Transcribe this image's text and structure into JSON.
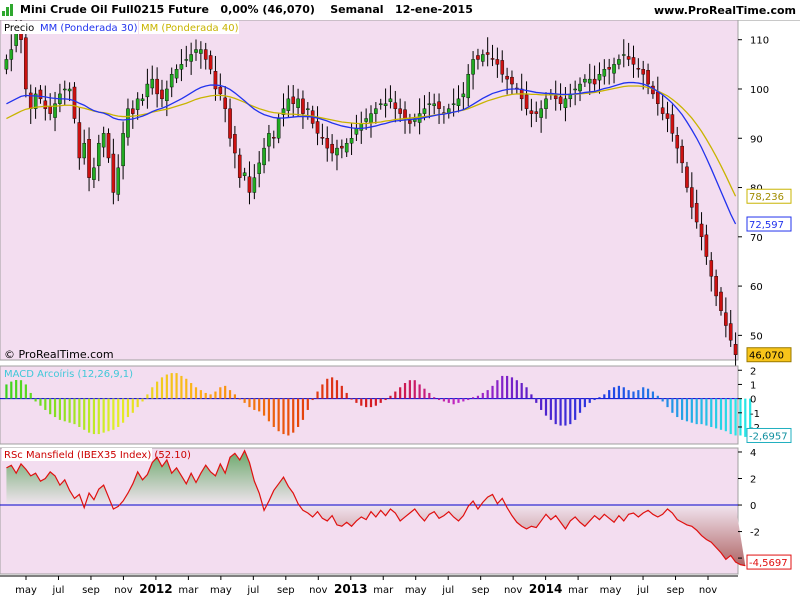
{
  "header": {
    "instrument": "Mini Crude Oil Full0215 Future",
    "change": "0,00% (46,070)",
    "period": "Semanal",
    "date": "12-ene-2015",
    "site": "www.ProRealTime.com"
  },
  "colors": {
    "panel_bg": "#f3ddf0",
    "ma30": "#2233ee",
    "ma40": "#c8b400",
    "candle_up": "#22aa22",
    "candle_down": "#cc1111",
    "rsc_line": "#e01010"
  },
  "chart_data": [
    {
      "type": "candlestick",
      "panel": "price",
      "legend": [
        "Precio",
        "MM (Ponderada 30)",
        "MM (Ponderada 40)"
      ],
      "y_ticks": [
        110,
        100,
        90,
        80,
        70,
        60,
        50
      ],
      "ylim": [
        45,
        114
      ],
      "last_labels": {
        "ma40": "78,236",
        "ma30": "72,597",
        "close": "46,070"
      },
      "watermark": "© ProRealTime.com",
      "x_ticks": [
        "may",
        "jul",
        "sep",
        "nov",
        "2012",
        "mar",
        "may",
        "jul",
        "sep",
        "nov",
        "2013",
        "mar",
        "may",
        "jul",
        "sep",
        "nov",
        "2014",
        "mar",
        "may",
        "jul",
        "sep",
        "nov"
      ],
      "close": [
        106,
        108,
        112,
        110,
        100,
        96,
        99,
        98,
        96,
        95,
        97,
        99,
        100,
        100,
        94,
        86,
        89,
        82,
        84,
        89,
        91,
        86,
        79,
        84,
        91,
        96,
        95,
        98,
        98,
        101,
        102,
        99,
        98,
        100,
        103,
        104,
        105,
        106,
        107,
        108,
        108,
        106,
        104,
        100,
        99,
        96,
        90,
        87,
        82,
        83,
        79,
        82,
        85,
        88,
        91,
        90,
        94,
        96,
        98,
        97,
        98,
        95,
        96,
        93,
        91,
        90,
        88,
        87,
        88,
        88,
        89,
        90,
        92,
        93,
        94,
        95,
        96,
        97,
        97,
        98,
        96,
        95,
        94,
        93,
        94,
        95,
        96,
        97,
        97,
        96,
        95,
        96,
        97,
        98,
        99,
        103,
        106,
        106,
        107,
        107,
        106,
        105,
        103,
        102,
        101,
        100,
        98,
        96,
        95,
        95,
        96,
        98,
        99,
        98,
        97,
        98,
        99,
        100,
        101,
        102,
        102,
        101,
        103,
        104,
        104,
        105,
        106,
        107,
        106,
        105,
        104,
        103,
        101,
        99,
        97,
        95,
        94,
        91,
        88,
        85,
        80,
        76,
        73,
        70,
        66,
        62,
        58,
        55,
        52,
        49,
        46.07
      ],
      "ma30": [
        97,
        97.5,
        98,
        98.5,
        98.7,
        98.6,
        98.6,
        98.5,
        98.4,
        98.2,
        98.1,
        98,
        98,
        97.9,
        97.6,
        97.1,
        96.7,
        96.1,
        95.6,
        95.3,
        95.1,
        94.7,
        94.1,
        93.8,
        93.7,
        93.8,
        93.9,
        94.2,
        94.5,
        94.9,
        95.4,
        95.8,
        96.1,
        96.5,
        97,
        97.5,
        98,
        98.6,
        99.2,
        99.8,
        100.3,
        100.6,
        100.8,
        100.8,
        100.7,
        100.4,
        99.9,
        99.2,
        98.4,
        97.6,
        96.7,
        95.9,
        95.3,
        94.8,
        94.5,
        94.2,
        94.1,
        94.1,
        94.2,
        94.3,
        94.4,
        94.4,
        94.4,
        94.3,
        94.1,
        93.8,
        93.5,
        93.1,
        92.8,
        92.5,
        92.3,
        92.1,
        92,
        92,
        92.1,
        92.3,
        92.5,
        92.8,
        93,
        93.3,
        93.5,
        93.6,
        93.7,
        93.8,
        93.9,
        94,
        94.2,
        94.4,
        94.6,
        94.8,
        94.9,
        95.1,
        95.3,
        95.5,
        95.8,
        96.3,
        96.9,
        97.5,
        98.1,
        98.6,
        99.1,
        99.4,
        99.7,
        99.9,
        100,
        100,
        99.9,
        99.7,
        99.5,
        99.3,
        99.2,
        99.1,
        99.1,
        99,
        98.9,
        98.9,
        98.9,
        99,
        99.1,
        99.3,
        99.4,
        99.5,
        99.8,
        100.1,
        100.3,
        100.6,
        100.9,
        101.2,
        101.3,
        101.3,
        101.2,
        101,
        100.6,
        100.1,
        99.5,
        98.8,
        98,
        97.1,
        96,
        94.8,
        93.3,
        91.7,
        90,
        88.1,
        86,
        83.8,
        81.5,
        79.2,
        76.9,
        74.6,
        72.597
      ],
      "ma40": [
        94,
        94.5,
        95,
        95.5,
        95.9,
        96.1,
        96.3,
        96.4,
        96.5,
        96.5,
        96.5,
        96.6,
        96.7,
        96.7,
        96.6,
        96.3,
        96.1,
        95.8,
        95.5,
        95.3,
        95.2,
        95,
        94.7,
        94.5,
        94.4,
        94.4,
        94.5,
        94.6,
        94.8,
        95,
        95.3,
        95.5,
        95.7,
        95.9,
        96.2,
        96.5,
        96.8,
        97.1,
        97.5,
        97.9,
        98.2,
        98.4,
        98.6,
        98.7,
        98.7,
        98.6,
        98.4,
        98.1,
        97.7,
        97.3,
        96.8,
        96.4,
        96,
        95.7,
        95.4,
        95.2,
        95.1,
        95,
        94.9,
        94.9,
        94.8,
        94.7,
        94.6,
        94.5,
        94.3,
        94.1,
        93.9,
        93.7,
        93.5,
        93.3,
        93.2,
        93.1,
        93,
        93,
        93,
        93.1,
        93.2,
        93.3,
        93.5,
        93.6,
        93.8,
        93.9,
        94,
        94.1,
        94.2,
        94.3,
        94.4,
        94.5,
        94.7,
        94.8,
        95,
        95.1,
        95.3,
        95.5,
        95.7,
        96,
        96.4,
        96.8,
        97.2,
        97.6,
        97.9,
        98.2,
        98.5,
        98.7,
        98.9,
        99,
        99,
        99,
        98.9,
        98.9,
        98.8,
        98.8,
        98.8,
        98.8,
        98.8,
        98.8,
        98.9,
        98.9,
        99,
        99.1,
        99.2,
        99.3,
        99.5,
        99.7,
        99.9,
        100.1,
        100.3,
        100.5,
        100.6,
        100.6,
        100.6,
        100.5,
        100.3,
        100,
        99.6,
        99.1,
        98.6,
        97.9,
        97.1,
        96.2,
        95.2,
        94.1,
        92.8,
        91.4,
        89.8,
        88.1,
        86.3,
        84.4,
        82.4,
        80.3,
        78.236
      ]
    },
    {
      "type": "bar",
      "panel": "macd",
      "legend": "MACD Arcoíris (12,26,9,1)",
      "y_ticks": [
        2,
        1,
        0,
        -1,
        -2
      ],
      "ylim": [
        -3.2,
        2.3
      ],
      "last_label": "-2,6957",
      "values": [
        1,
        1.2,
        1.4,
        1.3,
        1,
        0.4,
        -0.2,
        -0.5,
        -0.8,
        -1.1,
        -1.3,
        -1.5,
        -1.6,
        -1.7,
        -1.8,
        -2,
        -2.2,
        -2.4,
        -2.5,
        -2.5,
        -2.4,
        -2.3,
        -2.2,
        -2,
        -1.7,
        -1.3,
        -1,
        -0.6,
        -0.2,
        0.3,
        0.8,
        1.2,
        1.5,
        1.7,
        1.8,
        1.8,
        1.6,
        1.4,
        1.1,
        0.8,
        0.6,
        0.4,
        0.3,
        0.5,
        0.8,
        0.9,
        0.6,
        0.3,
        0,
        -0.3,
        -0.6,
        -0.8,
        -0.9,
        -1.2,
        -1.6,
        -2,
        -2.3,
        -2.5,
        -2.6,
        -2.4,
        -2,
        -1.5,
        -0.8,
        -0.1,
        0.5,
        1,
        1.4,
        1.5,
        1.3,
        0.9,
        0.4,
        0,
        -0.3,
        -0.5,
        -0.6,
        -0.6,
        -0.5,
        -0.3,
        -0.1,
        0.2,
        0.5,
        0.8,
        1.1,
        1.3,
        1.3,
        1,
        0.7,
        0.4,
        0.1,
        -0.1,
        -0.2,
        -0.3,
        -0.4,
        -0.3,
        -0.2,
        -0.1,
        0.1,
        0.2,
        0.4,
        0.6,
        0.9,
        1.3,
        1.6,
        1.6,
        1.5,
        1.3,
        1.1,
        0.8,
        0.3,
        -0.3,
        -0.8,
        -1.2,
        -1.5,
        -1.8,
        -1.9,
        -1.9,
        -1.8,
        -1.5,
        -1,
        -0.6,
        -0.3,
        -0.1,
        0.1,
        0.3,
        0.6,
        0.8,
        0.9,
        0.8,
        0.6,
        0.5,
        0.6,
        0.8,
        0.7,
        0.5,
        0.2,
        -0.2,
        -0.6,
        -1,
        -1.3,
        -1.5,
        -1.6,
        -1.7,
        -1.8,
        -1.8,
        -1.9,
        -2,
        -2.1,
        -2.2,
        -2.3,
        -2.5,
        -2.6,
        -2.6,
        -2.7,
        -2.6957
      ]
    },
    {
      "type": "area",
      "panel": "rsc",
      "legend": "RSc Mansfield (IBEX35 Index) (52.10)",
      "y_ticks": [
        4,
        2,
        0,
        -2,
        -4
      ],
      "ylim": [
        -5.2,
        4.3
      ],
      "last_label": "-4,5697",
      "values": [
        2.8,
        3,
        2.4,
        3.1,
        2.7,
        2.2,
        2.4,
        1.8,
        2,
        2.5,
        2.2,
        1.5,
        1.9,
        1.1,
        0.5,
        0.8,
        -0.2,
        0.9,
        0.4,
        1.2,
        1.5,
        0.6,
        -0.3,
        -0.1,
        0.3,
        0.9,
        1.6,
        2.5,
        1.9,
        2.3,
        3.2,
        3.6,
        2.9,
        3.4,
        2.4,
        2.8,
        2.2,
        1.6,
        2.4,
        1.7,
        2.4,
        3,
        2.5,
        2.2,
        3.1,
        2.4,
        3.6,
        3.9,
        3.4,
        4.1,
        3.2,
        1.8,
        0.9,
        -0.4,
        0.3,
        1.1,
        1.6,
        2.1,
        1.4,
        0.9,
        0.1,
        -0.4,
        -0.6,
        -0.9,
        -0.5,
        -1,
        -1.2,
        -0.8,
        -1.5,
        -1.6,
        -1.3,
        -1.6,
        -1.2,
        -0.9,
        -1.1,
        -0.5,
        -0.9,
        -0.4,
        -0.8,
        -0.3,
        -0.6,
        -1.2,
        -0.9,
        -0.6,
        -0.3,
        -0.8,
        -1.2,
        -0.7,
        -0.5,
        -1,
        -0.8,
        -0.5,
        -0.9,
        -1.2,
        -0.8,
        -0.1,
        0.3,
        -0.3,
        0.2,
        0.6,
        0.8,
        0.1,
        0.5,
        -0.2,
        -0.8,
        -1.3,
        -1.6,
        -1.8,
        -1.6,
        -1.7,
        -1.2,
        -0.7,
        -1.1,
        -0.8,
        -1.3,
        -1.8,
        -1.2,
        -0.9,
        -1.3,
        -1.6,
        -1.2,
        -0.8,
        -1.1,
        -0.7,
        -1,
        -1.3,
        -0.8,
        -1.2,
        -0.7,
        -0.6,
        -0.9,
        -0.6,
        -0.4,
        -0.7,
        -0.9,
        -0.7,
        -0.3,
        -0.6,
        -1.1,
        -1.3,
        -1.5,
        -1.6,
        -1.9,
        -2.3,
        -2.6,
        -2.8,
        -3.2,
        -3.6,
        -4.1,
        -3.8,
        -4.3,
        -4.5,
        -4.5697
      ]
    }
  ]
}
